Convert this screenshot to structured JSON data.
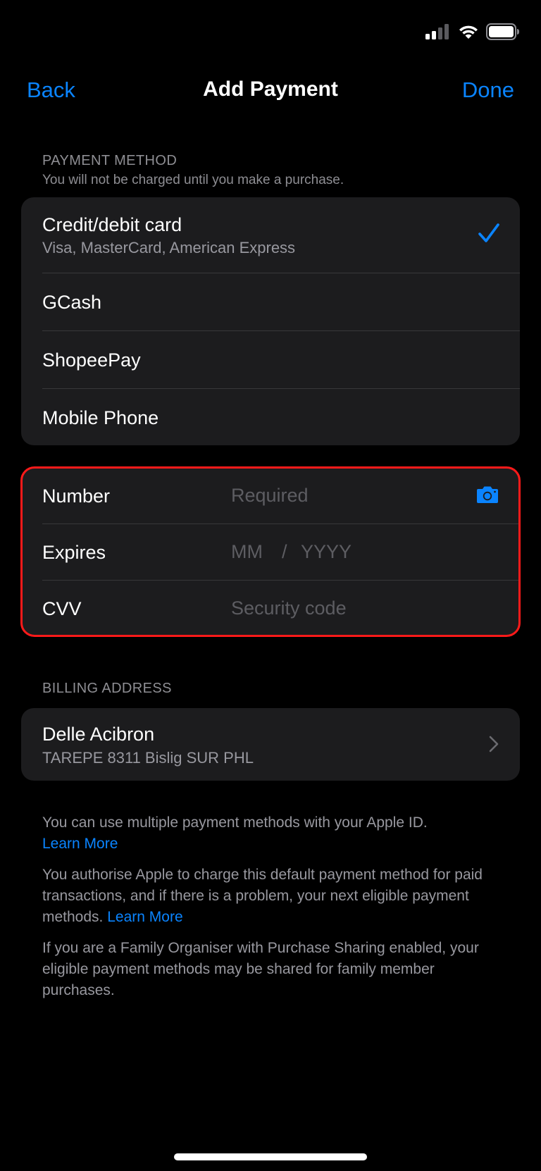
{
  "nav": {
    "back_label": "Back",
    "title": "Add Payment",
    "done_label": "Done"
  },
  "payment_method": {
    "header": "PAYMENT METHOD",
    "subheader": "You will not be charged until you make a purchase.",
    "options": [
      {
        "label": "Credit/debit card",
        "detail": "Visa, MasterCard, American Express",
        "selected": true
      },
      {
        "label": "GCash"
      },
      {
        "label": "ShopeePay"
      },
      {
        "label": "Mobile Phone"
      }
    ]
  },
  "card_fields": {
    "number_label": "Number",
    "number_placeholder": "Required",
    "expires_label": "Expires",
    "expires_month_placeholder": "MM",
    "expires_separator": "/",
    "expires_year_placeholder": "YYYY",
    "cvv_label": "CVV",
    "cvv_placeholder": "Security code"
  },
  "billing": {
    "header": "BILLING ADDRESS",
    "name": "Delle Acibron",
    "address": "TAREPE 8311 Bislig SUR PHL"
  },
  "footer": {
    "p1_text": "You can use multiple payment methods with your Apple ID.",
    "p1_link": "Learn More",
    "p2_text": "You authorise Apple to charge this default payment method for paid transactions, and if there is a problem, your next eligible payment methods.",
    "p2_link": "Learn More",
    "p3_text": "If you are a Family Organiser with Purchase Sharing enabled, your eligible payment methods may be shared for family member purchases."
  },
  "colors": {
    "accent": "#0a84ff",
    "background": "#000000",
    "cell": "#1c1c1e",
    "highlight": "#ff1a1a"
  },
  "icons": [
    "cellular-signal-icon",
    "wifi-icon",
    "battery-icon",
    "checkmark-icon",
    "camera-icon",
    "chevron-right-icon"
  ]
}
